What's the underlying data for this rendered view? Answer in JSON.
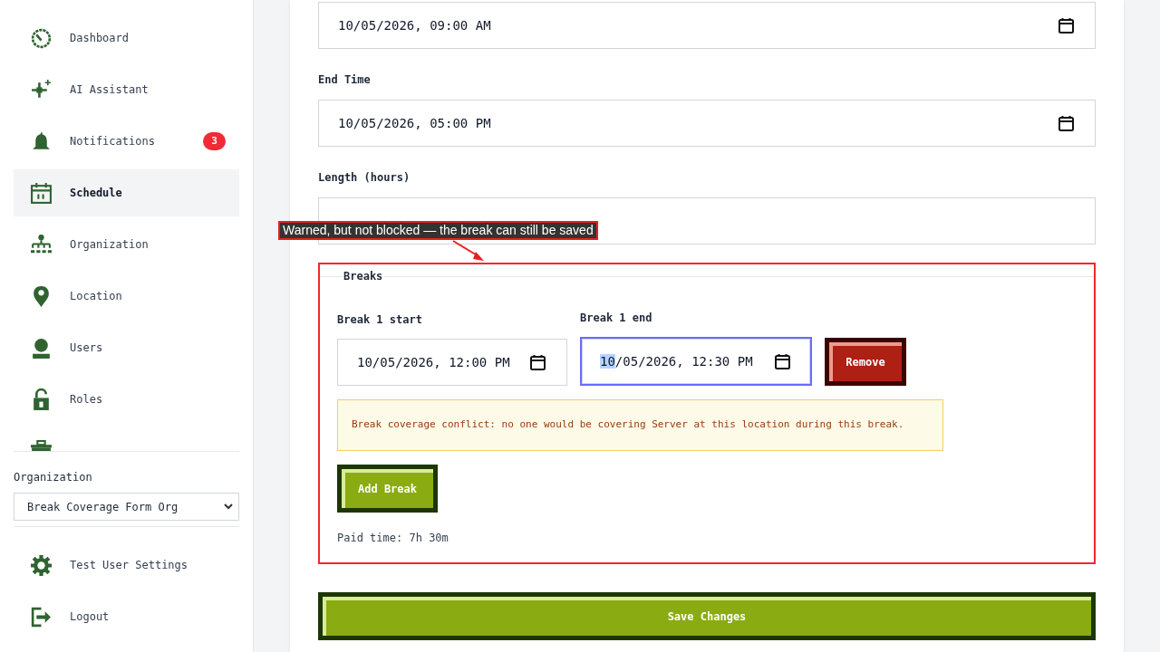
{
  "sidebar": {
    "nav_items": [
      {
        "label": "Dashboard",
        "selected": false
      },
      {
        "label": "AI Assistant",
        "selected": false
      },
      {
        "label": "Notifications",
        "selected": false,
        "badge": "3"
      },
      {
        "label": "Schedule",
        "selected": true
      },
      {
        "label": "Organization",
        "selected": false
      },
      {
        "label": "Location",
        "selected": false
      },
      {
        "label": "Users",
        "selected": false
      },
      {
        "label": "Roles",
        "selected": false
      }
    ],
    "organization_switcher": {
      "label": "Organization",
      "value": "Break Coverage Form Org"
    },
    "footer_items": [
      {
        "label": "Test User Settings"
      },
      {
        "label": "Logout"
      }
    ]
  },
  "form": {
    "fields": [
      {
        "kind": "datetime",
        "value": "10/05/2026, 09:00 AM"
      },
      {
        "kind": "datetime",
        "label": "End Time",
        "value": "10/05/2026, 05:00 PM"
      },
      {
        "kind": "number",
        "label": "Length (hours)"
      }
    ],
    "breaks": {
      "legend": "Breaks",
      "items": [
        {
          "start_label": "Break 1 start",
          "start_value": "10/05/2026, 12:00 PM",
          "end_label": "Break 1 end",
          "end_value": "10/05/2026, 12:30 PM",
          "end_focused": true,
          "remove_label": "Remove"
        }
      ],
      "warning": "Break coverage conflict: no one would be covering Server at this location during this break.",
      "add_label": "Add Break",
      "paid_time": "Paid time: 7h 30m"
    },
    "save_label": "Save Changes"
  },
  "annotation": {
    "text": "Warned, but not blocked — the break can still be saved"
  }
}
